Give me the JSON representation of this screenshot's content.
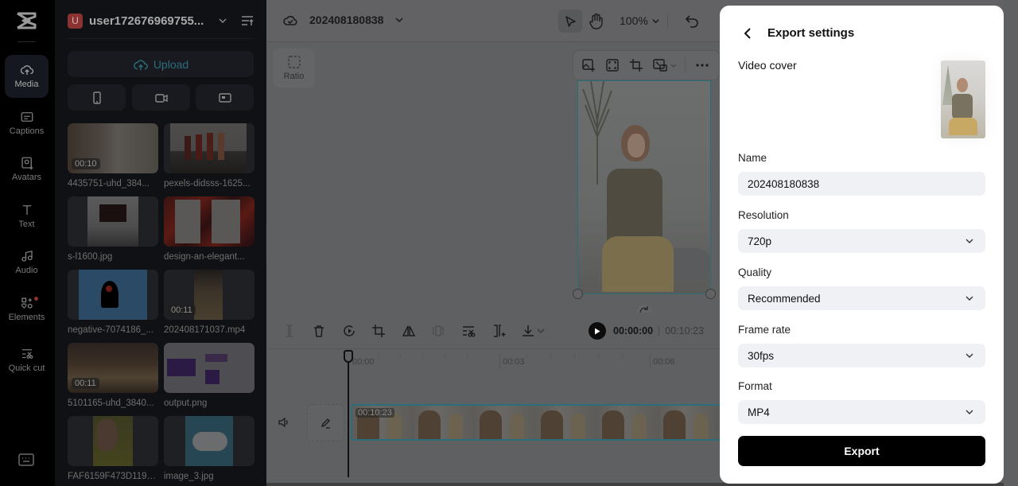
{
  "rail": {
    "items": [
      {
        "label": "Media",
        "icon": "cloud-upload-icon",
        "active": true
      },
      {
        "label": "Captions",
        "icon": "captions-icon"
      },
      {
        "label": "Avatars",
        "icon": "avatar-icon"
      },
      {
        "label": "Text",
        "icon": "text-icon"
      },
      {
        "label": "Audio",
        "icon": "music-note-icon"
      },
      {
        "label": "Elements",
        "icon": "elements-icon",
        "badge": true
      },
      {
        "label": "Quick cut",
        "icon": "quick-cut-icon"
      }
    ]
  },
  "media": {
    "user": {
      "initial": "U",
      "name": "user172676969755..."
    },
    "upload_label": "Upload",
    "tiles": [
      {
        "name": "4435751-uhd_384...",
        "duration": "00:10"
      },
      {
        "name": "pexels-didsss-1625..."
      },
      {
        "name": "s-l1600.jpg"
      },
      {
        "name": "design-an-elegant..."
      },
      {
        "name": "negative-7074186_..."
      },
      {
        "name": "202408171037.mp4",
        "duration": "00:11"
      },
      {
        "name": "5101165-uhd_3840...",
        "duration": "00:11"
      },
      {
        "name": "output.png"
      },
      {
        "name": "FAF6159F473D1194..."
      },
      {
        "name": "image_3.jpg"
      }
    ]
  },
  "editor": {
    "project_name": "202408180838",
    "zoom": "100%",
    "ratio_label": "Ratio",
    "timecode_current": "00:00:00",
    "timecode_total": "00:10:23",
    "ruler": [
      "00:00",
      "00:03",
      "00:06"
    ],
    "clip_duration": "00:10:23"
  },
  "export": {
    "title": "Export settings",
    "video_cover_label": "Video cover",
    "name_label": "Name",
    "name_value": "202408180838",
    "resolution_label": "Resolution",
    "resolution_value": "720p",
    "quality_label": "Quality",
    "quality_value": "Recommended",
    "framerate_label": "Frame rate",
    "framerate_value": "30fps",
    "format_label": "Format",
    "format_value": "MP4",
    "export_button": "Export"
  }
}
